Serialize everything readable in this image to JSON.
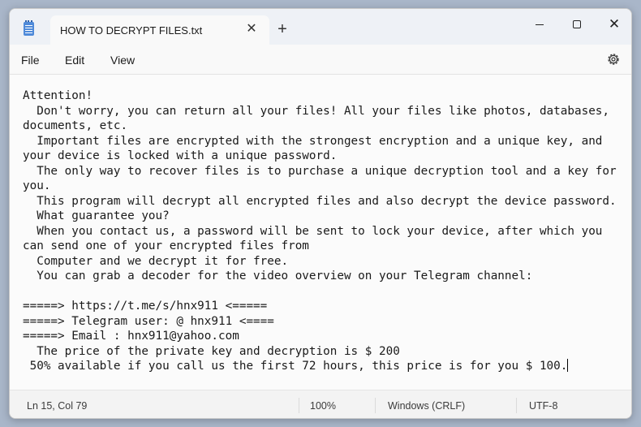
{
  "window": {
    "tab_title": "HOW TO DECRYPT FILES.txt",
    "tab_close": "✕",
    "new_tab": "+",
    "close": "✕"
  },
  "menu": {
    "file": "File",
    "edit": "Edit",
    "view": "View"
  },
  "icons": {
    "app": "notepad-icon",
    "settings": "gear-icon"
  },
  "editor": {
    "lines": [
      "Attention!",
      "  Don't worry, you can return all your files! All your files like photos, databases,",
      "documents, etc.",
      "  Important files are encrypted with the strongest encryption and a unique key, and",
      "your device is locked with a unique password.",
      "  The only way to recover files is to purchase a unique decryption tool and a key for",
      "you.",
      "  This program will decrypt all encrypted files and also decrypt the device password.",
      "  What guarantee you?",
      "  When you contact us, a password will be sent to lock your device, after which you",
      "can send one of your encrypted files from",
      "  Computer and we decrypt it for free.",
      "  You can grab a decoder for the video overview on your Telegram channel:",
      "",
      "=====> https://t.me/s/hnx911 <=====",
      "=====> Telegram user: @ hnx911 <====",
      "=====> Email : hnx911@yahoo.com",
      "  The price of the private key and decryption is $ 200",
      " 50% available if you call us the first 72 hours, this price is for you $ 100."
    ]
  },
  "status": {
    "position": "Ln 15, Col 79",
    "zoom": "100%",
    "line_endings": "Windows (CRLF)",
    "encoding": "UTF-8"
  }
}
